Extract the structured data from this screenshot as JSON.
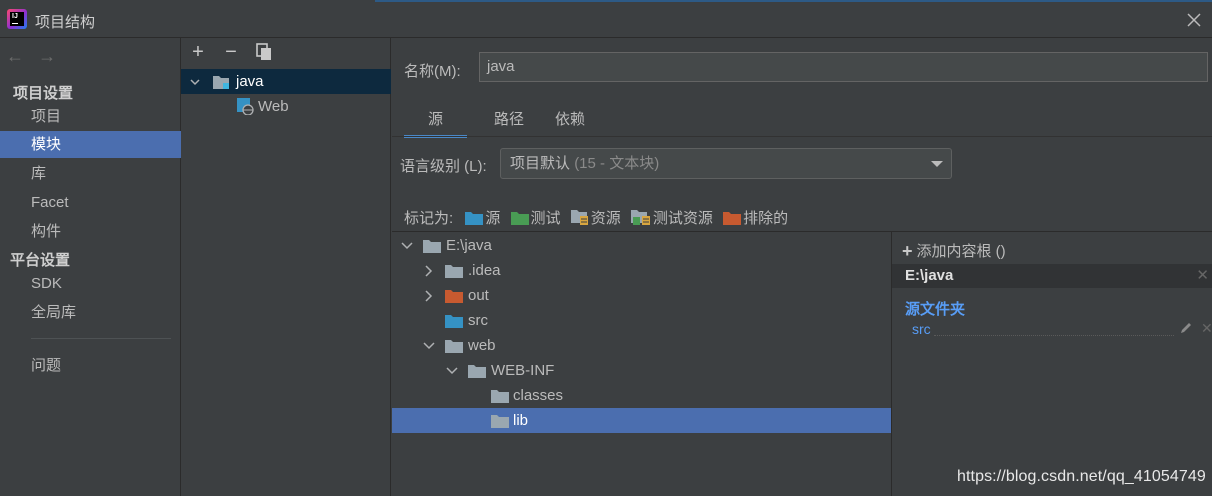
{
  "window": {
    "title": "项目结构"
  },
  "nav": {
    "back": "←",
    "forward": "→",
    "section_project": "项目设置",
    "items_project": [
      "项目",
      "模块",
      "库",
      "Facet",
      "构件"
    ],
    "section_platform": "平台设置",
    "items_platform": [
      "SDK",
      "全局库"
    ],
    "problems": "问题",
    "selected": "模块"
  },
  "modules": {
    "toolbar": {
      "add": "+",
      "remove": "−"
    },
    "tree": [
      {
        "label": "java",
        "selected": true,
        "expanded": true
      },
      {
        "label": "Web",
        "selected": false
      }
    ]
  },
  "module": {
    "name_label": "名称(M):",
    "name_value": "java",
    "tabs": [
      "源",
      "路径",
      "依赖"
    ],
    "active_tab": "源",
    "language_level_label": "语言级别 (L):",
    "language_level_value": "项目默认",
    "language_level_hint": "(15 - 文本块)",
    "mark_as_label": "标记为:",
    "mark_as": [
      {
        "label": "源",
        "color": "#3592c4"
      },
      {
        "label": "测试",
        "color": "#499c54"
      },
      {
        "label": "资源",
        "color": "#9aa7b0"
      },
      {
        "label": "测试资源",
        "color": "#9aa7b0"
      },
      {
        "label": "排除的",
        "color": "#c75a30"
      }
    ]
  },
  "file_tree": [
    {
      "label": "E:\\java",
      "chevron": "down",
      "color": "#9aa7b0"
    },
    {
      "label": ".idea",
      "chevron": "right",
      "color": "#9aa7b0"
    },
    {
      "label": "out",
      "chevron": "right",
      "color": "#c75a30"
    },
    {
      "label": "src",
      "chevron": "",
      "color": "#3592c4"
    },
    {
      "label": "web",
      "chevron": "down",
      "color": "#9aa7b0"
    },
    {
      "label": "WEB-INF",
      "chevron": "down",
      "color": "#9aa7b0"
    },
    {
      "label": "classes",
      "chevron": "",
      "color": "#9aa7b0"
    },
    {
      "label": "lib",
      "chevron": "",
      "color": "#9aa7b0",
      "selected": true
    }
  ],
  "content_roots": {
    "add_label": "添加内容根 ()",
    "root": "E:\\java",
    "source_folders_title": "源文件夹",
    "source_entry": "src"
  },
  "watermark": "https://blog.csdn.net/qq_41054749"
}
